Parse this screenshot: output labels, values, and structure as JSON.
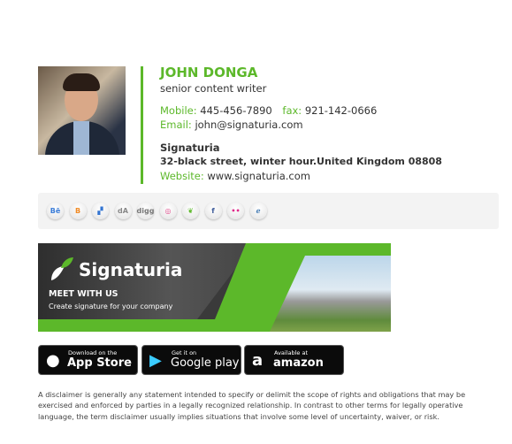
{
  "profile": {
    "name": "JOHN DONGA",
    "title": "senior content writer"
  },
  "contact": {
    "mobile_label": "Mobile:",
    "mobile": "445-456-7890",
    "fax_label": "fax:",
    "fax": "921-142-0666",
    "email_label": "Email:",
    "email": "john@signaturia.com"
  },
  "company": {
    "name": "Signaturia",
    "address": "32-black street, winter hour.United Kingdom 08808",
    "website_label": "Website:",
    "website": "www.signaturia.com"
  },
  "social": [
    {
      "icon": "behance-icon",
      "glyph": "Bē",
      "color": "#3b7dd8"
    },
    {
      "icon": "blogger-icon",
      "glyph": "B",
      "color": "#f08a24"
    },
    {
      "icon": "delicious-icon",
      "glyph": "▞",
      "color": "#3274d1"
    },
    {
      "icon": "deviantart-icon",
      "glyph": "dA",
      "color": "#888888"
    },
    {
      "icon": "digg-icon",
      "glyph": "digg",
      "color": "#777777"
    },
    {
      "icon": "dribbble-icon",
      "glyph": "◎",
      "color": "#e04c8c"
    },
    {
      "icon": "evernote-icon",
      "glyph": "❦",
      "color": "#5cb82a"
    },
    {
      "icon": "facebook-icon",
      "glyph": "f",
      "color": "#3b5998"
    },
    {
      "icon": "flickr-icon",
      "glyph": "••",
      "color": "#e0288a"
    },
    {
      "icon": "forrst-icon",
      "glyph": "ℯ",
      "color": "#4a7fb5"
    }
  ],
  "banner": {
    "logo": "Signaturia",
    "heading": "MEET WITH US",
    "subtext": "Create signature for your company"
  },
  "stores": [
    {
      "small": "Download on the",
      "big": "App Store",
      "icon": "apple-icon"
    },
    {
      "small": "Get it on",
      "big": "Google play",
      "icon": "google-play-icon"
    },
    {
      "small": "Available at",
      "big": "amazon",
      "icon": "amazon-icon"
    }
  ],
  "disclaimer": "A disclaimer is generally any statement intended to specify or delimit the scope of rights and obligations that may be exercised and enforced by parties in a legally recognized relationship. In contrast to other terms for legally operative language, the term disclaimer usually implies situations that involve some level of uncertainty, waiver, or risk.",
  "colors": {
    "accent": "#5cb82a"
  }
}
